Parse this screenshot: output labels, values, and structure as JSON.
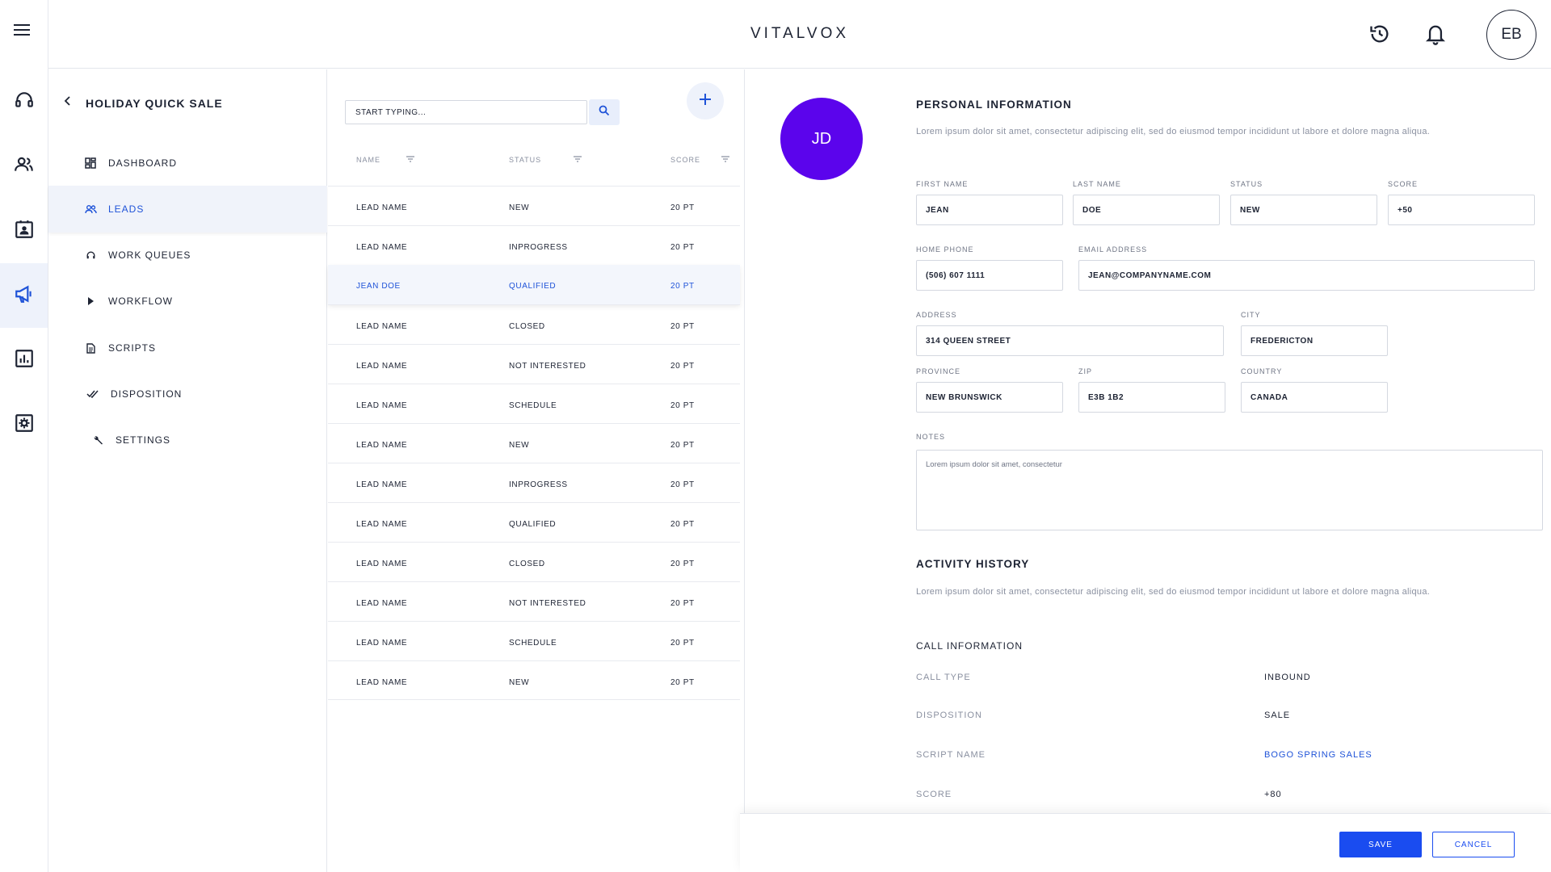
{
  "app": {
    "brand": "VITALVOX",
    "user_initials": "EB"
  },
  "icons": {
    "menu": "hamburger-menu-icon",
    "rail": [
      "headset-icon",
      "contacts-icon",
      "contact-card-icon",
      "megaphone-icon",
      "bar-chart-icon",
      "settings-gear-icon"
    ],
    "top": [
      "history-icon",
      "bell-icon"
    ]
  },
  "colors": {
    "accent": "#1f53d8",
    "avatar": "#5b04ec",
    "selected_bg": "#f3f6fc"
  },
  "subnav": {
    "title": "HOLIDAY QUICK SALE",
    "items": [
      {
        "label": "DASHBOARD",
        "icon": "dashboard-icon"
      },
      {
        "label": "LEADS",
        "icon": "people-icon",
        "active": true
      },
      {
        "label": "WORK QUEUES",
        "icon": "headset-icon"
      },
      {
        "label": "WORKFLOW",
        "icon": "play-arrow-icon"
      },
      {
        "label": "SCRIPTS",
        "icon": "document-icon"
      },
      {
        "label": "DISPOSITION",
        "icon": "double-check-icon"
      },
      {
        "label": "SETTINGS",
        "icon": "wrench-icon"
      }
    ]
  },
  "list": {
    "search_placeholder": "START TYPING...",
    "columns": {
      "name": "NAME",
      "status": "STATUS",
      "score": "SCORE"
    },
    "rows": [
      {
        "name": "LEAD NAME",
        "status": "NEW",
        "score": "20 PT"
      },
      {
        "name": "LEAD NAME",
        "status": "INPROGRESS",
        "score": "20 PT"
      },
      {
        "name": "JEAN DOE",
        "status": "QUALIFIED",
        "score": "20 PT"
      },
      {
        "name": "LEAD NAME",
        "status": "CLOSED",
        "score": "20 PT"
      },
      {
        "name": "LEAD NAME",
        "status": "NOT INTERESTED",
        "score": "20 PT"
      },
      {
        "name": "LEAD NAME",
        "status": "SCHEDULE",
        "score": "20 PT"
      },
      {
        "name": "LEAD NAME",
        "status": "NEW",
        "score": "20 PT"
      },
      {
        "name": "LEAD NAME",
        "status": "INPROGRESS",
        "score": "20 PT"
      },
      {
        "name": "LEAD NAME",
        "status": "QUALIFIED",
        "score": "20 PT"
      },
      {
        "name": "LEAD NAME",
        "status": "CLOSED",
        "score": "20 PT"
      },
      {
        "name": "LEAD NAME",
        "status": "NOT INTERESTED",
        "score": "20 PT"
      },
      {
        "name": "LEAD NAME",
        "status": "SCHEDULE",
        "score": "20 PT"
      },
      {
        "name": "LEAD NAME",
        "status": "NEW",
        "score": "20 PT"
      }
    ]
  },
  "detail": {
    "initials": "JD",
    "personal": {
      "title": "PERSONAL INFORMATION",
      "desc": "Lorem ipsum dolor sit amet, consectetur adipiscing elit, sed do eiusmod tempor incididunt ut labore et dolore magna aliqua.",
      "labels": {
        "first_name": "FIRST NAME",
        "last_name": "LAST NAME",
        "status": "STATUS",
        "score": "SCORE",
        "home_phone": "HOME PHONE",
        "email": "EMAIL ADDRESS",
        "address": "ADDRESS",
        "city": "CITY",
        "province": "PROVINCE",
        "zip": "ZIP",
        "country": "COUNTRY",
        "notes": "NOTES"
      },
      "values": {
        "first_name": "JEAN",
        "last_name": "DOE",
        "status": "NEW",
        "score": "+50",
        "home_phone": "(506) 607 1111",
        "email": "JEAN@COMPANYNAME.COM",
        "address": "314 QUEEN STREET",
        "city": "FREDERICTON",
        "province": "NEW BRUNSWICK",
        "zip": "E3B 1B2",
        "country": "CANADA",
        "notes": "Lorem ipsum dolor sit amet, consectetur"
      }
    },
    "activity": {
      "title": "ACTIVITY HISTORY",
      "desc": "Lorem ipsum dolor sit amet, consectetur adipiscing elit, sed do eiusmod tempor incididunt ut labore et dolore magna aliqua.",
      "call_info_title": "CALL INFORMATION",
      "items": [
        {
          "key": "CALL TYPE",
          "value": "INBOUND"
        },
        {
          "key": "DISPOSITION",
          "value": "SALE"
        },
        {
          "key": "SCRIPT NAME",
          "value": "BOGO SPRING SALES"
        },
        {
          "key": "SCORE",
          "value": "+80"
        }
      ]
    }
  },
  "footer": {
    "save": "SAVE",
    "cancel": "CANCEL"
  }
}
